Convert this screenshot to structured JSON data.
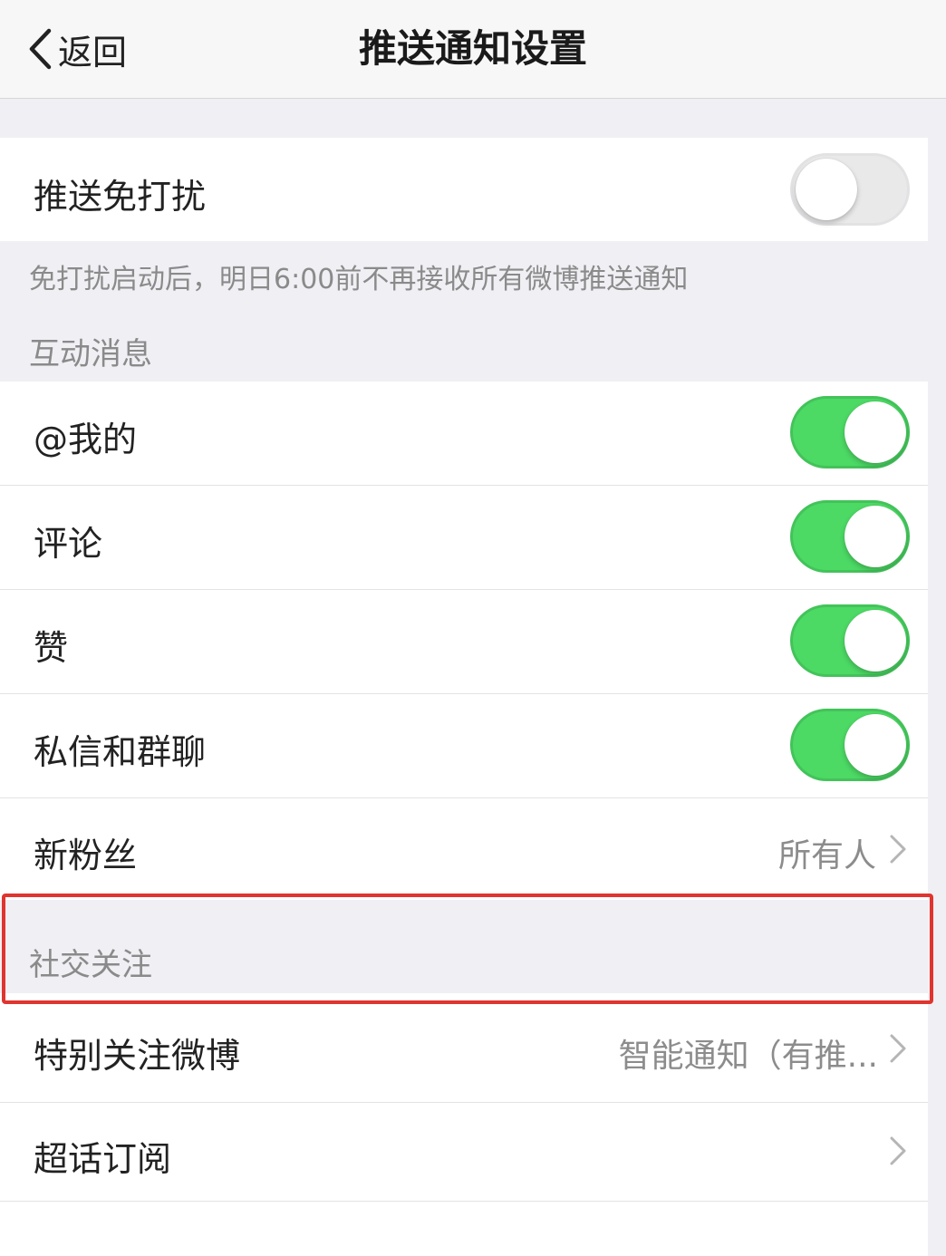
{
  "header": {
    "back_label": "返回",
    "title": "推送通知设置"
  },
  "dnd": {
    "label": "推送免打扰",
    "enabled": false,
    "hint": "免打扰启动后，明日6:00前不再接收所有微博推送通知"
  },
  "interaction": {
    "section_title": "互动消息",
    "items": [
      {
        "label": "@我的",
        "enabled": true
      },
      {
        "label": "评论",
        "enabled": true
      },
      {
        "label": "赞",
        "enabled": true
      },
      {
        "label": "私信和群聊",
        "enabled": true
      }
    ],
    "new_fans": {
      "label": "新粉丝",
      "value": "所有人"
    }
  },
  "social": {
    "section_title": "社交关注",
    "special_follow": {
      "label": "特别关注微博",
      "value": "智能通知（有推..."
    },
    "super_topic": {
      "label": "超话订阅"
    },
    "partial_next_label": "",
    "chevron_icon": "chevron-right-icon"
  },
  "colors": {
    "toggle_on": "#4cd964",
    "toggle_off": "#e9e9ea",
    "highlight": "#e0342f",
    "background": "#efeff4"
  }
}
